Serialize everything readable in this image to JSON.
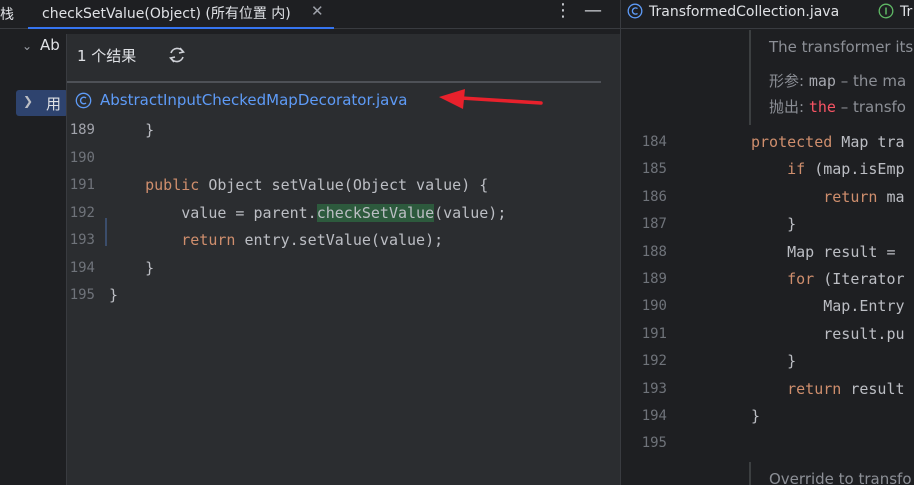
{
  "left_tabs": {
    "frag": "栈",
    "find_tab_label": "checkSetValue(Object) (所有位置 内)"
  },
  "tree": {
    "item1": "Ab",
    "item2": "用"
  },
  "popup": {
    "result_count": "1 个结果",
    "file_name": "AbstractInputCheckedMapDecorator.java",
    "lines": [
      {
        "n": "189",
        "t": "    }"
      },
      {
        "n": "190",
        "t": ""
      },
      {
        "n": "191",
        "t": "    public Object setValue(Object value) {"
      },
      {
        "n": "192",
        "t": "        value = parent.checkSetValue(value);"
      },
      {
        "n": "193",
        "t": "        return entry.setValue(value);"
      },
      {
        "n": "194",
        "t": "    }"
      },
      {
        "n": "195",
        "t": "}"
      }
    ]
  },
  "right": {
    "tab1": "TransformedCollection.java",
    "tab2": "Tr",
    "doc1": "The transformer its",
    "doc2_label": "形参: ",
    "doc2_code": "map",
    "doc2_rest": " – the ma",
    "doc3_label": "抛出: ",
    "doc3_code": "the",
    "doc3_rest": " – transfo",
    "doc_bottom": "Override to transfo",
    "lines": [
      {
        "n": "184",
        "t": "protected Map tra"
      },
      {
        "n": "185",
        "t": "    if (map.isEmp"
      },
      {
        "n": "186",
        "t": "        return ma"
      },
      {
        "n": "187",
        "t": "    }"
      },
      {
        "n": "188",
        "t": "    Map result ="
      },
      {
        "n": "189",
        "t": "    for (Iterator"
      },
      {
        "n": "190",
        "t": "        Map.Entry"
      },
      {
        "n": "191",
        "t": "        result.pu"
      },
      {
        "n": "192",
        "t": "    }"
      },
      {
        "n": "193",
        "t": "    return result"
      },
      {
        "n": "194",
        "t": "}"
      },
      {
        "n": "195",
        "t": ""
      }
    ]
  },
  "colors": {
    "accent": "#3574f0",
    "link": "#5e9bf7",
    "keyword": "#cf8e6d",
    "arrow": "#e8212c",
    "highlight": "#2d5a3d"
  }
}
